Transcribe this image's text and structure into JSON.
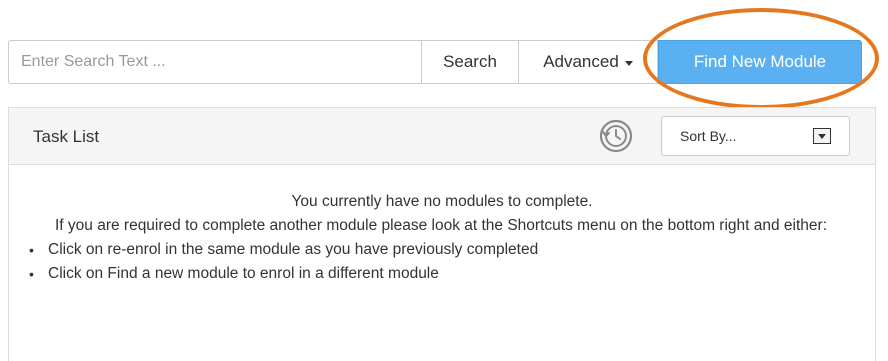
{
  "search": {
    "placeholder": "Enter Search Text ...",
    "value": "",
    "search_label": "Search",
    "advanced_label": "Advanced",
    "find_new_label": "Find New Module"
  },
  "task_list": {
    "title": "Task List",
    "sort_label": "Sort By...",
    "message_line1": "You currently have no modules to complete.",
    "message_line2": "If you are required to complete another module please look at the Shortcuts menu on the bottom right and either:",
    "bullets": [
      "Click on re-enrol in the same module as you have previously completed",
      "Click on Find a new module to enrol in a different module"
    ]
  },
  "colors": {
    "primary_button": "#5bb0f1",
    "highlight_ellipse": "#e5781e"
  },
  "icons": {
    "history": "history-icon",
    "dropdown": "chevron-down-icon",
    "caret": "caret-down-icon"
  }
}
